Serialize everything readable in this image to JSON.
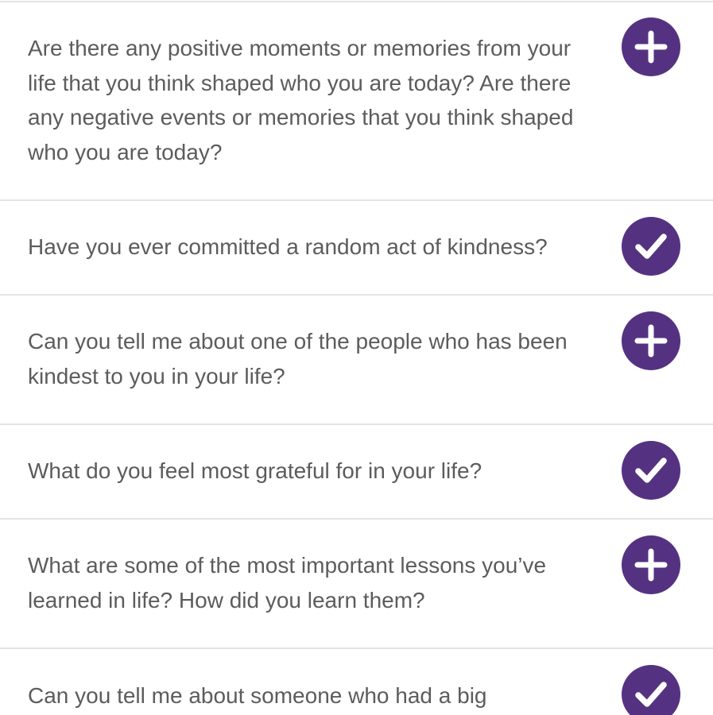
{
  "colors": {
    "accent": "#553281",
    "text": "#5c5c5c",
    "divider": "#e3e3e3",
    "background": "#ffffff"
  },
  "questions": [
    {
      "text": "Are there any positive moments or memories from your life that you think shaped who you are today? Are there any negative events or memories that you think shaped who you are today?",
      "status": "add",
      "icon": "plus-icon"
    },
    {
      "text": "Have you ever committed a random act of kindness?",
      "status": "answered",
      "icon": "check-icon"
    },
    {
      "text": "Can you tell me about one of the people who has been kindest to you in your life?",
      "status": "add",
      "icon": "plus-icon"
    },
    {
      "text": "What do you feel most grateful for in your life?",
      "status": "answered",
      "icon": "check-icon"
    },
    {
      "text": "What are some of the most important lessons you’ve learned in life? How did you learn them?",
      "status": "add",
      "icon": "plus-icon"
    },
    {
      "text": "Can you tell me about someone who had a big",
      "status": "answered",
      "icon": "check-icon"
    }
  ]
}
